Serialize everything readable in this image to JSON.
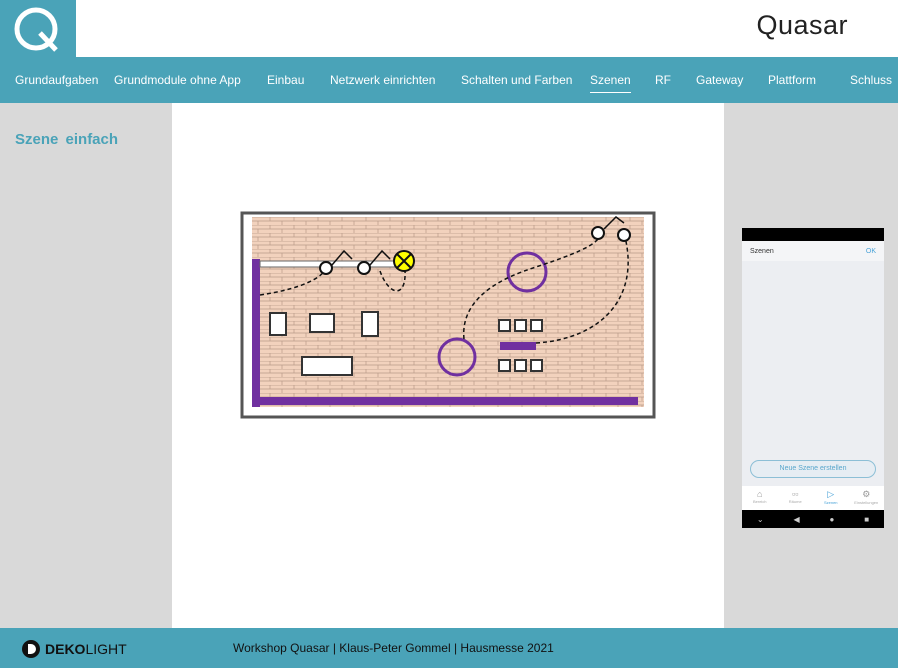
{
  "brand": "Quasar",
  "nav": [
    {
      "label": "Grundaufgaben"
    },
    {
      "label": "Grundmodule ohne App"
    },
    {
      "label": "Einbau"
    },
    {
      "label": "Netzwerk einrichten"
    },
    {
      "label": "Schalten und Farben"
    },
    {
      "label": "Szenen",
      "active": true
    },
    {
      "label": "RF"
    },
    {
      "label": "Gateway"
    },
    {
      "label": "Plattform"
    },
    {
      "label": "Schluss"
    }
  ],
  "section_title": "Szene  einfach",
  "phone": {
    "title": "Szenen",
    "ok": "OK",
    "new_scene": "Neue Szene erstellen",
    "tabs": [
      "Bereich",
      "Räume",
      "Szenen",
      "Einstellungen"
    ]
  },
  "footer": {
    "logo_bold": "DEKO",
    "logo_light": "LIGHT",
    "text": "Workshop Quasar | Klaus-Peter Gommel | Hausmesse 2021"
  },
  "colors": {
    "accent": "#4aa3b8",
    "purple": "#7030a0"
  }
}
